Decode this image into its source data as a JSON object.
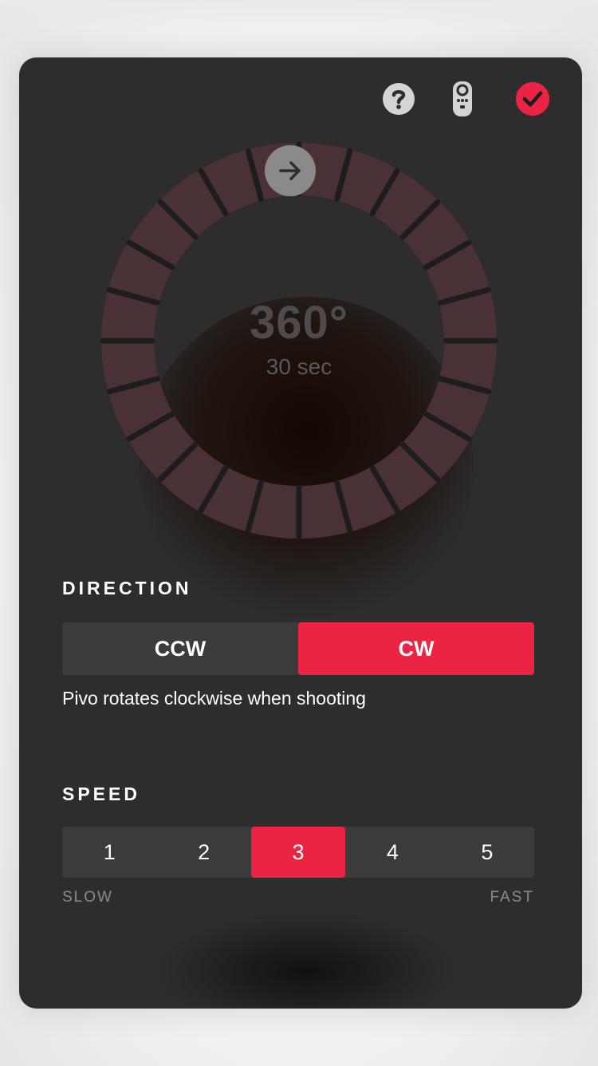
{
  "header": {
    "help_icon": "question-circle-icon",
    "remote_icon": "remote-control-icon",
    "confirm_icon": "check-circle-icon"
  },
  "dial": {
    "angle": "360°",
    "duration": "30 sec",
    "handle_icon": "arrow-right-icon",
    "tick_count": 24,
    "ring_color": "#4a3135",
    "tick_color": "#1d1d1d"
  },
  "direction": {
    "title": "DIRECTION",
    "options": [
      "CCW",
      "CW"
    ],
    "selected": "CW",
    "description": "Pivo rotates clockwise when shooting"
  },
  "speed": {
    "title": "SPEED",
    "options": [
      "1",
      "2",
      "3",
      "4",
      "5"
    ],
    "selected": "3",
    "slow_label": "SLOW",
    "fast_label": "FAST"
  },
  "colors": {
    "accent": "#ec2444",
    "panel": "#2d2d2e",
    "segment_bg": "#3b3b3c"
  }
}
